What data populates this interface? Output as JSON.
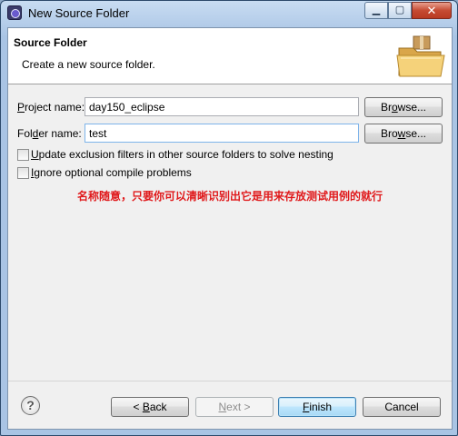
{
  "window": {
    "title": "New Source Folder",
    "controls": {
      "minimize": "▁",
      "maximize": "▢",
      "close": "✕"
    }
  },
  "header": {
    "title": "Source Folder",
    "description": "Create a new source folder.",
    "icon": "folder-with-package-icon"
  },
  "form": {
    "project": {
      "label_pre": "",
      "label_acc": "P",
      "label_post": "roject name:",
      "value": "day150_eclipse",
      "browse_pre": "Br",
      "browse_acc": "o",
      "browse_post": "wse..."
    },
    "folder": {
      "label_pre": "Fol",
      "label_acc": "d",
      "label_post": "er name:",
      "value": "test",
      "browse_pre": "Bro",
      "browse_acc": "w",
      "browse_post": "se..."
    },
    "checkboxes": [
      {
        "label_acc": "U",
        "label_post": "pdate exclusion filters in other source folders to solve nesting",
        "checked": false
      },
      {
        "label_acc": "I",
        "label_post": "gnore optional compile problems",
        "checked": false
      }
    ]
  },
  "annotation": "名称随意，只要你可以清晰识别出它是用来存放测试用例的就行",
  "footer": {
    "help": "?",
    "back_pre": "< ",
    "back_acc": "B",
    "back_post": "ack",
    "next_acc": "N",
    "next_post": "ext >",
    "finish_acc": "F",
    "finish_post": "inish",
    "cancel": "Cancel"
  },
  "colors": {
    "annotation": "#e0191b",
    "title_bar": "#a9c4e4",
    "close_button": "#c64b33"
  }
}
